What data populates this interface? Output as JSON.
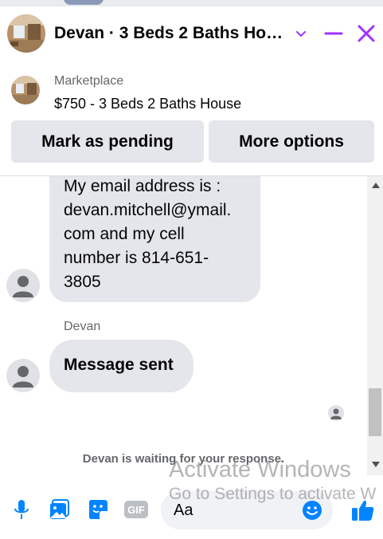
{
  "header": {
    "title": "Devan · 3 Beds 2 Baths Ho…",
    "accent_color": "#a033ff"
  },
  "listing": {
    "label": "Marketplace",
    "title": "$750 - 3 Beds 2 Baths House",
    "buttons": {
      "mark_pending": "Mark as pending",
      "more_options": "More options"
    }
  },
  "messages": {
    "first": {
      "lines": [
        "My email address is :",
        "devan.mitchell@ymail.",
        "com and my cell",
        "number is 814-651-",
        "3805"
      ]
    },
    "second": {
      "sender": "Devan",
      "text": "Message sent"
    },
    "status": "Devan is waiting for your response."
  },
  "composer": {
    "placeholder": "Aa",
    "icons": [
      "microphone-icon",
      "photo-icon",
      "sticker-icon",
      "gif-icon",
      "emoji-icon",
      "like-icon"
    ],
    "gif_label": "GIF",
    "accent_color": "#0084ff"
  },
  "watermark": {
    "line1": "Activate Windows",
    "line2": "Go to Settings to activate W"
  }
}
